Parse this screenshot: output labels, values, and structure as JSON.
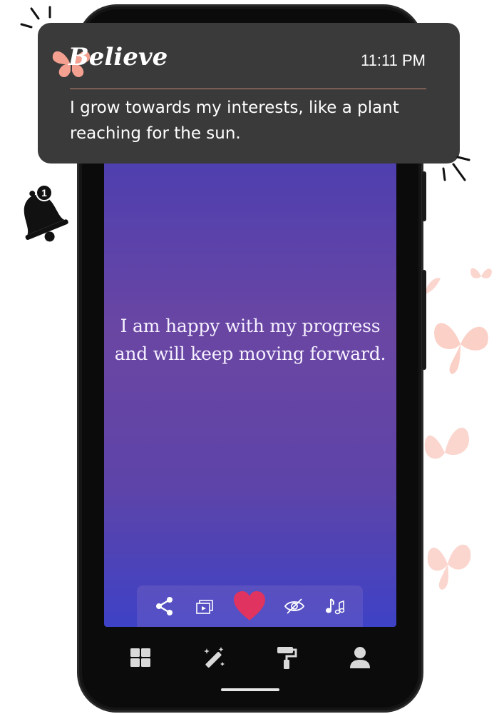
{
  "notification": {
    "app_name": "Believe",
    "time": "11:11 PM",
    "message": "I grow towards my interests, like a plant reaching for the sun.",
    "app_icon": "butterfly-icon"
  },
  "alert_bell": {
    "icon": "bell-icon",
    "badge_count": "1"
  },
  "affirmation": {
    "text": "I am happy with my progress and will keep moving forward."
  },
  "actions": [
    {
      "name": "share",
      "icon": "share-icon"
    },
    {
      "name": "slideshow",
      "icon": "slideshow-icon"
    },
    {
      "name": "favorite",
      "icon": "heart-icon",
      "active": true
    },
    {
      "name": "hide",
      "icon": "eye-off-icon"
    },
    {
      "name": "music",
      "icon": "music-note-icon"
    }
  ],
  "bottom_nav": [
    {
      "name": "categories",
      "icon": "grid-icon"
    },
    {
      "name": "magic",
      "icon": "magic-wand-icon"
    },
    {
      "name": "themes",
      "icon": "paint-roller-icon"
    },
    {
      "name": "profile",
      "icon": "user-icon"
    }
  ],
  "colors": {
    "heart": "#e0335f",
    "accent_butterfly": "#f4a090",
    "notification_bg": "#3a3a3a",
    "gradient_top": "#4d3fb0",
    "gradient_mid": "#6a46a3",
    "gradient_bottom": "#3e42c6"
  }
}
